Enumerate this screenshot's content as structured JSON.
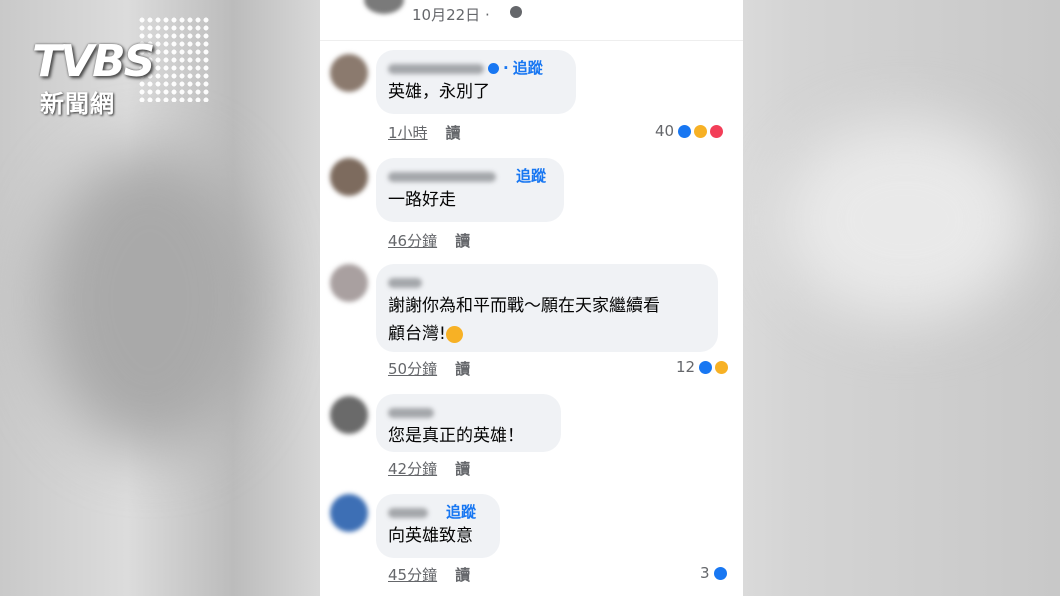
{
  "watermark": {
    "brand": "TVBS",
    "subtitle": "新聞網"
  },
  "post": {
    "date": "10月22日 ·",
    "privacy_icon": "globe-icon"
  },
  "comments": [
    {
      "text": "英雄，永別了",
      "follow": "追蹤",
      "time": "1小時",
      "reply": "讀",
      "reaction_count": "40",
      "reactions": [
        "like",
        "sad",
        "love"
      ],
      "verified": true
    },
    {
      "text": "一路好走",
      "follow": "追蹤",
      "time": "46分鐘",
      "reply": "讀",
      "reaction_count": "",
      "reactions": []
    },
    {
      "text_line1": "謝謝你為和平而戰～願在天家繼續看",
      "text_line2": "顧台灣!",
      "emoji": "😔",
      "time": "50分鐘",
      "reply": "讀",
      "reaction_count": "12",
      "reactions": [
        "like",
        "sad"
      ]
    },
    {
      "text": "您是真正的英雄！",
      "time": "42分鐘",
      "reply": "讀",
      "reaction_count": "",
      "reactions": []
    },
    {
      "text": "向英雄致意",
      "follow": "追蹤",
      "time": "45分鐘",
      "reply": "讀",
      "reaction_count": "3",
      "reactions": [
        "like"
      ]
    }
  ],
  "colors": {
    "accent": "#1877f2",
    "bubble": "#f0f2f5",
    "meta": "#65676b"
  }
}
